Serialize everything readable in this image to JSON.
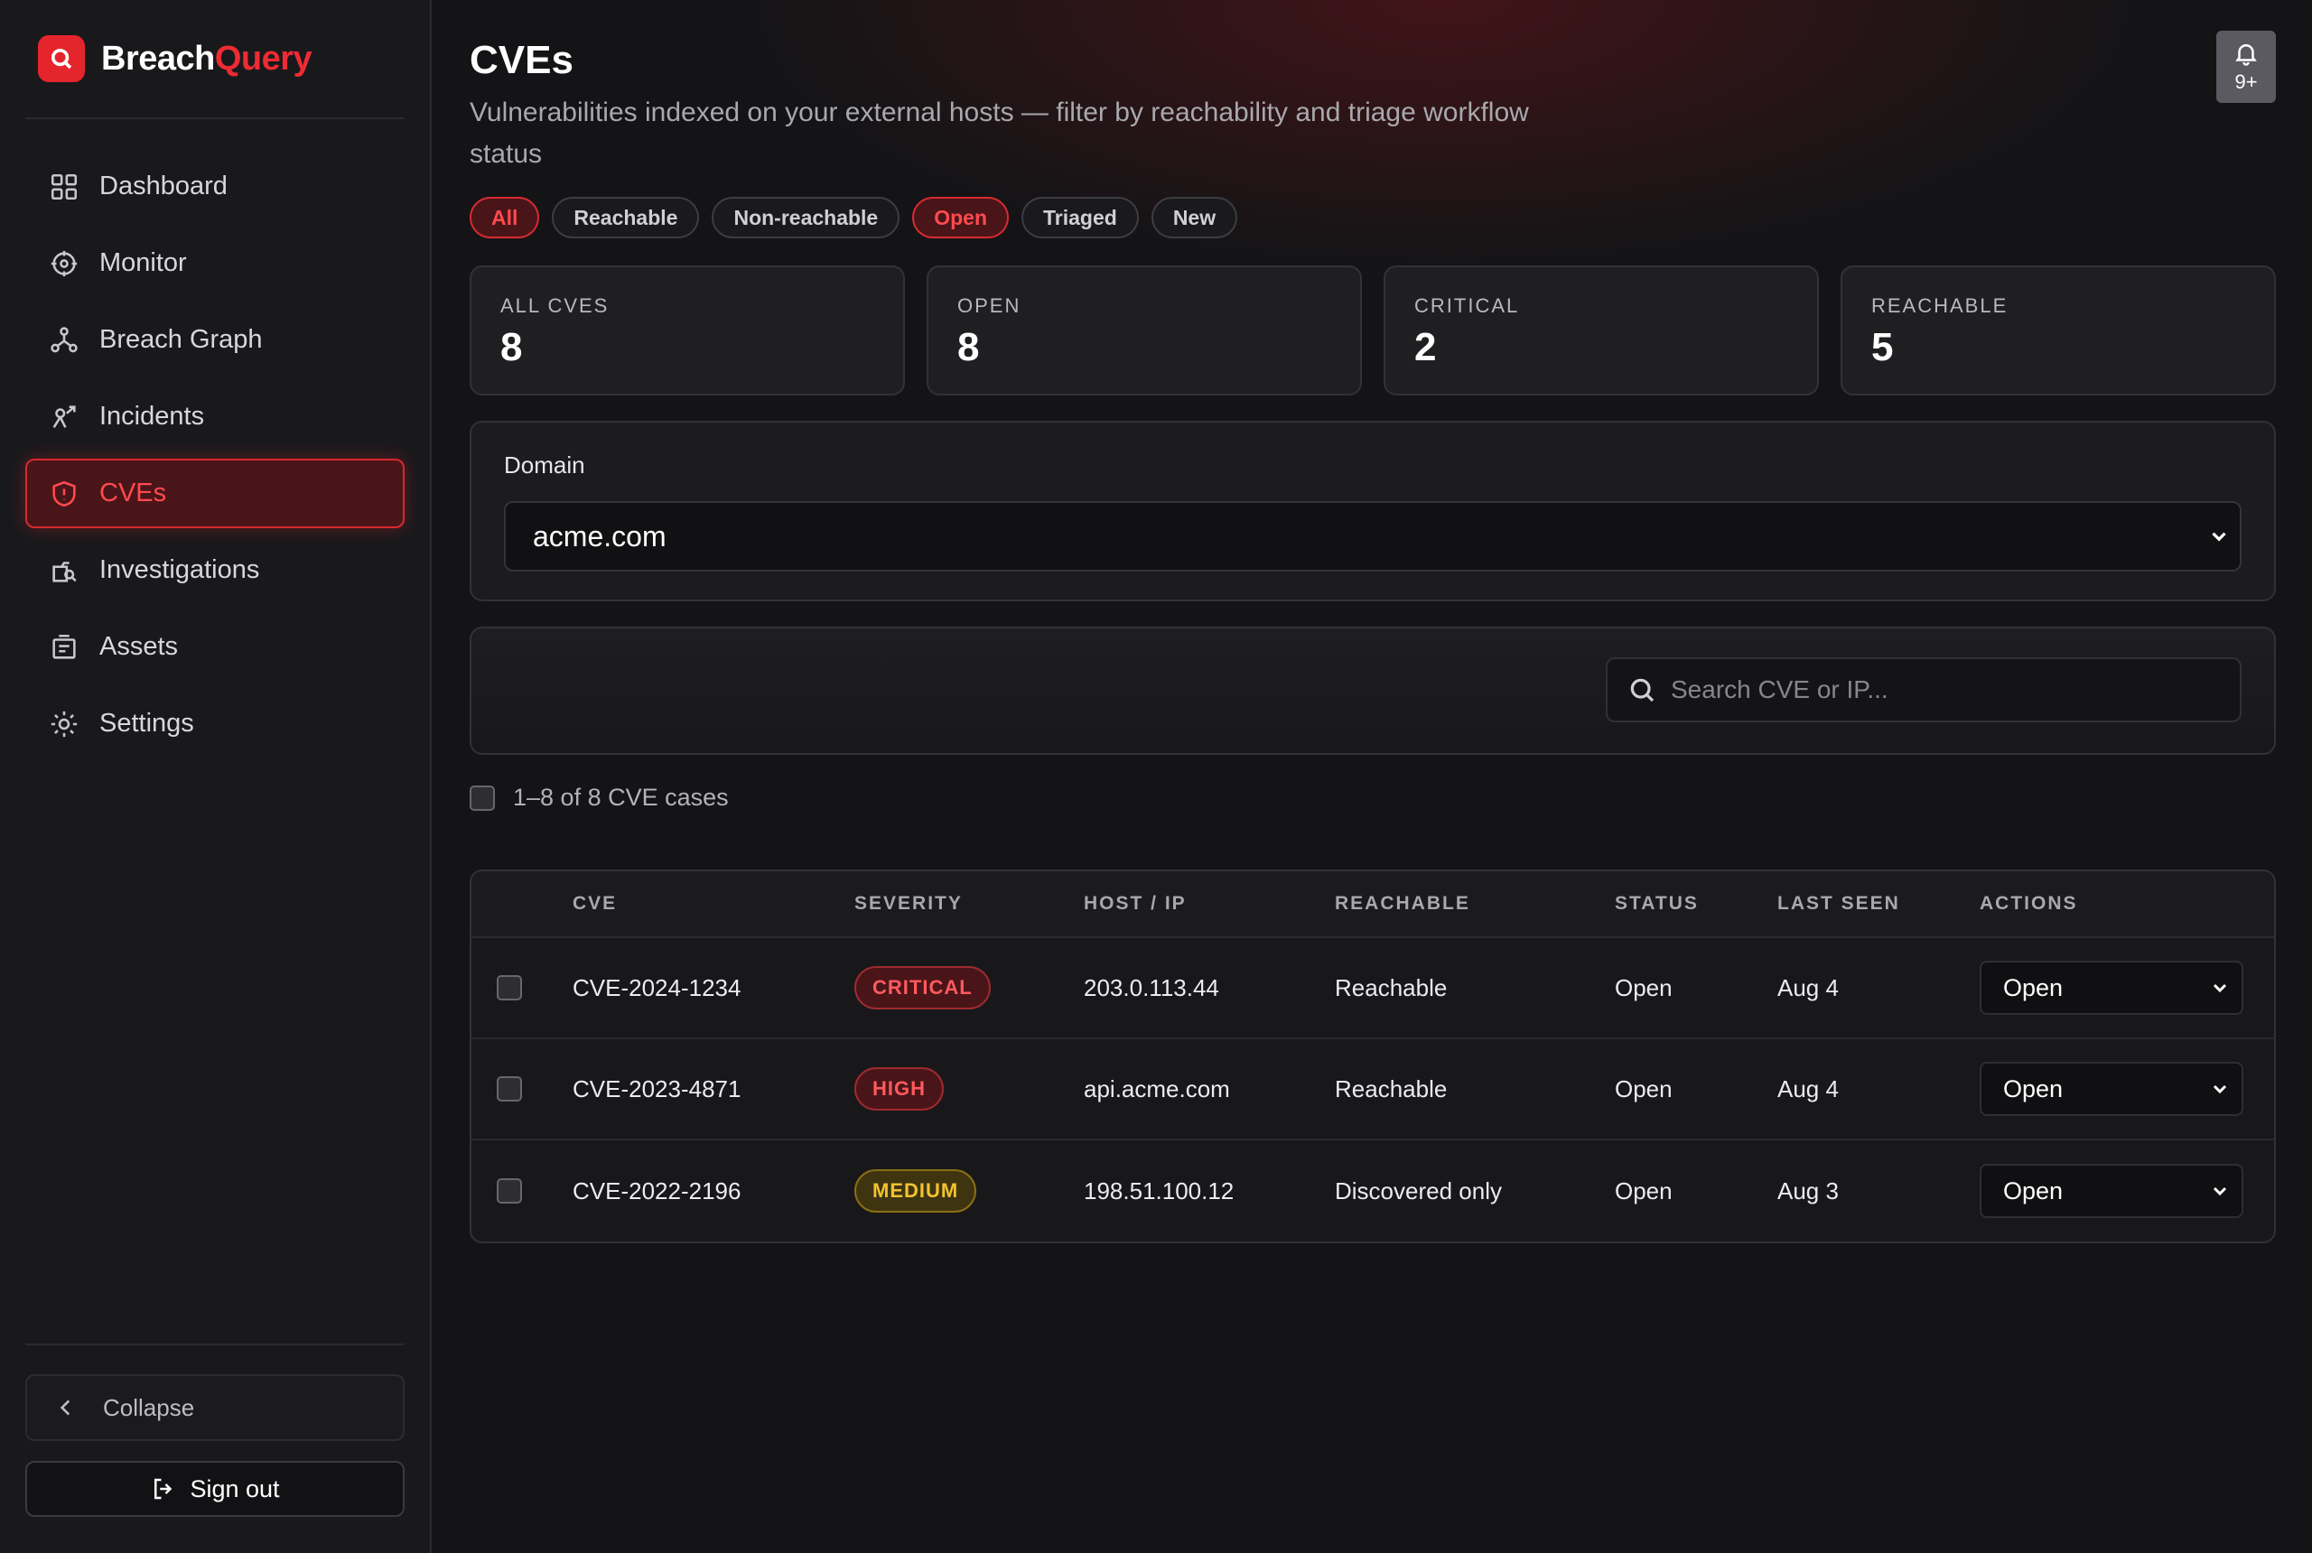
{
  "brand": {
    "name_part1": "Breach",
    "name_part2": "Query"
  },
  "sidebar": {
    "items": [
      {
        "label": "Dashboard"
      },
      {
        "label": "Monitor"
      },
      {
        "label": "Breach Graph"
      },
      {
        "label": "Incidents"
      },
      {
        "label": "CVEs",
        "active": true
      },
      {
        "label": "Investigations"
      },
      {
        "label": "Assets"
      },
      {
        "label": "Settings"
      }
    ],
    "collapse_label": "Collapse",
    "signout_label": "Sign out"
  },
  "header": {
    "title": "CVEs",
    "subtitle": "Vulnerabilities indexed on your external hosts — filter by reachability and triage workflow status",
    "notifications": "9+"
  },
  "filters": [
    {
      "label": "All",
      "active": true
    },
    {
      "label": "Reachable",
      "active": false
    },
    {
      "label": "Non-reachable",
      "active": false
    },
    {
      "label": "Open",
      "active": true
    },
    {
      "label": "Triaged",
      "active": false
    },
    {
      "label": "New",
      "active": false
    }
  ],
  "stats": [
    {
      "label": "ALL CVES",
      "value": "8"
    },
    {
      "label": "OPEN",
      "value": "8"
    },
    {
      "label": "CRITICAL",
      "value": "2"
    },
    {
      "label": "REACHABLE",
      "value": "5"
    }
  ],
  "domain": {
    "label": "Domain",
    "selected": "acme.com"
  },
  "search": {
    "placeholder": "Search CVE or IP..."
  },
  "results_count": "1–8 of 8 CVE cases",
  "table": {
    "columns": [
      "CVE",
      "SEVERITY",
      "HOST / IP",
      "REACHABLE",
      "STATUS",
      "LAST SEEN",
      "ACTIONS"
    ],
    "rows": [
      {
        "cve": "CVE-2024-1234",
        "severity": "CRITICAL",
        "host": "203.0.113.44",
        "reachable": "Reachable",
        "status": "Open",
        "last_seen": "Aug 4",
        "action": "Open"
      },
      {
        "cve": "CVE-2023-4871",
        "severity": "HIGH",
        "host": "api.acme.com",
        "reachable": "Reachable",
        "status": "Open",
        "last_seen": "Aug 4",
        "action": "Open"
      },
      {
        "cve": "CVE-2022-2196",
        "severity": "MEDIUM",
        "host": "198.51.100.12",
        "reachable": "Discovered only",
        "status": "Open",
        "last_seen": "Aug 3",
        "action": "Open"
      }
    ]
  },
  "colors": {
    "accent": "#e5252c",
    "background": "#141416",
    "sidebar": "#19191c",
    "medium": "#f2c230"
  },
  "icons": {
    "brand": "search-shield-icon",
    "nav": [
      "grid-icon",
      "target-icon",
      "graph-nodes-icon",
      "incident-icon",
      "shield-alert-icon",
      "investigate-icon",
      "assets-icon",
      "gear-icon"
    ],
    "collapse": "chevron-left-icon",
    "signout": "logout-icon",
    "bell": "bell-icon",
    "search": "search-icon",
    "select": "chevron-down-icon"
  }
}
